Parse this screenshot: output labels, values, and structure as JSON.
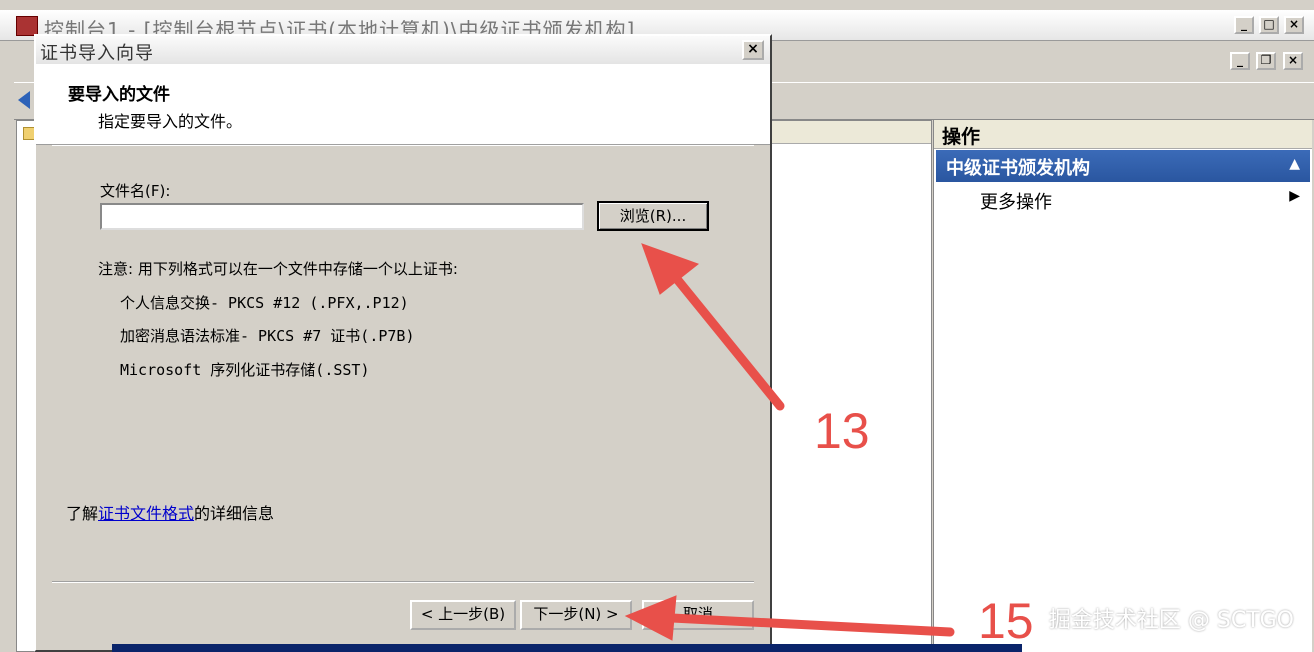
{
  "mmc": {
    "title": "控制台1 - [控制台根节点\\证书(本地计算机)\\中级证书颁发机构]",
    "window_buttons": {
      "minimize": "_",
      "maximize": "□",
      "close": "×"
    },
    "inner_buttons": {
      "minimize": "_",
      "restore": "❐",
      "close": "×"
    }
  },
  "actions_pane": {
    "header": "操作",
    "section_title": "中级证书颁发机构",
    "collapse_glyph": "▲",
    "items": [
      {
        "label": "更多操作",
        "arrow": "▶"
      }
    ]
  },
  "wizard": {
    "title": "证书导入向导",
    "close_glyph": "×",
    "header_title": "要导入的文件",
    "header_subtitle": "指定要导入的文件。",
    "file_label": "文件名(F):",
    "file_value": "",
    "browse_label": "浏览(R)...",
    "note": "注意: 用下列格式可以在一个文件中存储一个以上证书:",
    "formats": [
      "个人信息交换- PKCS #12 (.PFX,.P12)",
      "加密消息语法标准- PKCS #7 证书(.P7B)",
      "Microsoft 序列化证书存储(.SST)"
    ],
    "learn_prefix": "了解",
    "learn_link": "证书文件格式",
    "learn_suffix": "的详细信息",
    "back_label": "< 上一步(B)",
    "next_label": "下一步(N) >",
    "cancel_label": "取消"
  },
  "annotations": {
    "step_13": "13",
    "step_15": "15",
    "color": "#e8504a"
  },
  "watermark": "掘金技术社区 @ SCTGO"
}
